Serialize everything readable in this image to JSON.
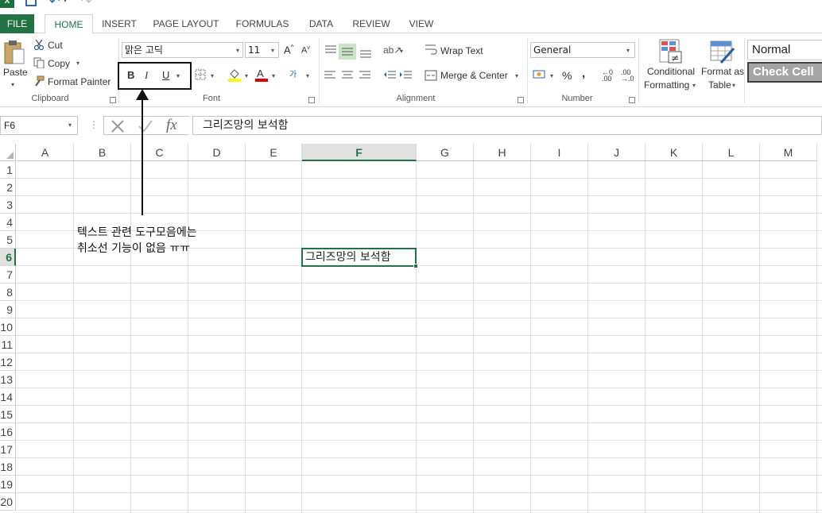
{
  "tabs": [
    "FILE",
    "HOME",
    "INSERT",
    "PAGE LAYOUT",
    "FORMULAS",
    "DATA",
    "REVIEW",
    "VIEW"
  ],
  "clipboard": {
    "paste": "Paste",
    "cut": "Cut",
    "copy": "Copy",
    "format_painter": "Format Painter",
    "label": "Clipboard"
  },
  "font": {
    "name": "맑은 고딕",
    "size": "11",
    "bold": "B",
    "italic": "I",
    "underline": "U",
    "label": "Font"
  },
  "alignment": {
    "wrap_text": "Wrap Text",
    "merge_center": "Merge & Center",
    "label": "Alignment"
  },
  "number": {
    "format": "General",
    "percent": "%",
    "comma": ",",
    "label": "Number"
  },
  "styles": {
    "conditional_1": "Conditional",
    "conditional_2": "Formatting",
    "format_as_1": "Format as",
    "format_as_2": "Table",
    "normal": "Normal",
    "check_cell": "Check Cell"
  },
  "formula_bar": {
    "name_box": "F6",
    "content": "그리즈망의 보석함"
  },
  "columns": [
    "A",
    "B",
    "C",
    "D",
    "E",
    "F",
    "G",
    "H",
    "I",
    "J",
    "K",
    "L",
    "M"
  ],
  "rows": [
    "1",
    "2",
    "3",
    "4",
    "5",
    "6",
    "7",
    "8",
    "9",
    "10",
    "11",
    "12",
    "13",
    "14",
    "15",
    "16",
    "17",
    "18",
    "19",
    "20"
  ],
  "active_cell": {
    "ref": "F6",
    "value": "그리즈망의 보석함"
  },
  "annotation": "텍스트 관련 도구모음에는\n취소선 기능이 없음 ㅠㅠ",
  "colors": {
    "accent": "#217346",
    "annotation": "#111111"
  }
}
